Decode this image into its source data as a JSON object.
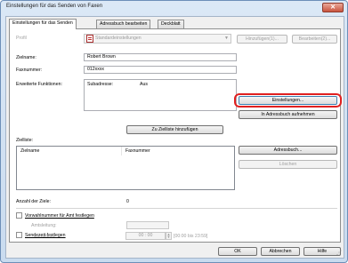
{
  "window": {
    "title": "Einstellungen für das Senden von Faxen",
    "close_glyph": "✕"
  },
  "tabs": [
    {
      "label": "Einstellungen für das Senden"
    },
    {
      "label": "Adressbuch bearbeiten"
    },
    {
      "label": "Deckblatt"
    }
  ],
  "profile": {
    "label": "Profil",
    "value": "Standardeinstellungen",
    "add_button": "Hinzufügen(1)...",
    "edit_button": "Bearbeiten(2)..."
  },
  "recipient": {
    "name_label": "Zielname:",
    "name_value": "Robert Brown",
    "fax_label": "Faxnummer:",
    "fax_value": "012xxxx",
    "ext_label": "Erweiterte Funktionen:",
    "subaddress_label": "Subadresse:",
    "subaddress_value": "Aus",
    "settings_button": "Einstellungen...",
    "add_to_addressbook_button": "In Adressbuch aufnehmen",
    "add_to_list_button": "Zu Zielliste hinzufügen"
  },
  "destination_list": {
    "label": "Zielliste:",
    "columns": [
      "Zielname",
      "Faxnummer"
    ],
    "addressbook_button": "Adressbuch...",
    "delete_button": "Löschen",
    "count_label": "Anzahl der Ziele:",
    "count_value": "0"
  },
  "options": {
    "prefix_label": "Vorwahlnummer für Amt festlegen",
    "outside_line_label": "Amtsleitung:",
    "send_time_label": "Sendezeit festlegen",
    "send_time_field_label": "Sendezeit:",
    "send_time_value": "00 : 00",
    "send_time_range": "[00:00 bis 23:59]"
  },
  "footer": {
    "ok": "OK",
    "cancel": "Abbrechen",
    "help": "Hilfe"
  }
}
